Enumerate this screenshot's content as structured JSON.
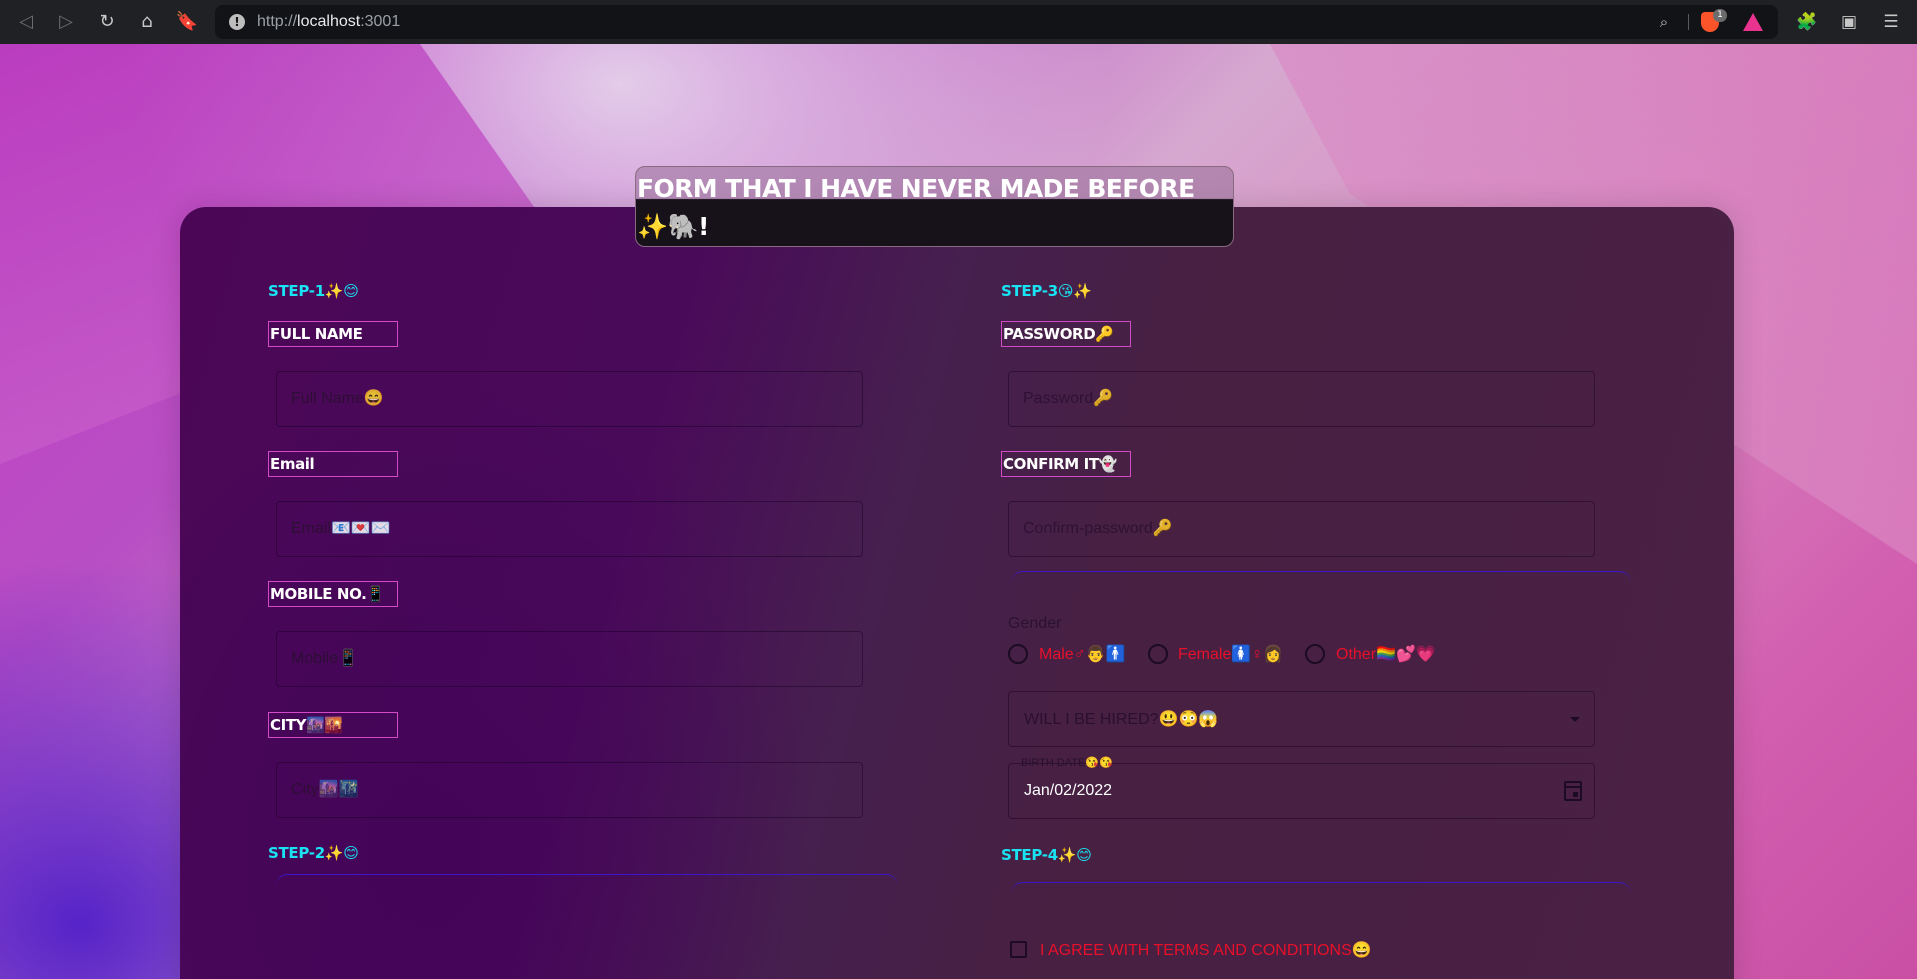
{
  "browser": {
    "url_prefix": "http://",
    "url_host": "localhost",
    "url_port": ":3001",
    "shields_count": "1",
    "icons": [
      "back-icon",
      "forward-icon",
      "reload-icon",
      "home-icon",
      "bookmark-icon",
      "info-icon",
      "zoom-icon",
      "brave-shields-icon",
      "brave-rewards-icon",
      "extensions-icon",
      "wallet-icon",
      "menu-icon"
    ]
  },
  "form": {
    "title": "FORM THAT I HAVE NEVER MADE BEFORE ✨🐘!",
    "steps": {
      "step1": "STEP-1✨😊",
      "step2": "STEP-2✨😊",
      "step3": "STEP-3😘✨",
      "step4": "STEP-4✨😊"
    },
    "left_fields": [
      {
        "label": "FULL NAME",
        "placeholder": "Full Name😄"
      },
      {
        "label": "Email",
        "placeholder": "Email📧💌✉️"
      },
      {
        "label": "MOBILE NO.📱",
        "placeholder": "Mobile📱"
      },
      {
        "label": "CITY🌆🌇",
        "placeholder": "City🌆🌃"
      }
    ],
    "right_fields": [
      {
        "label": "PASSWORD🔑",
        "placeholder": "Password🔑"
      },
      {
        "label": "CONFIRM IT👻",
        "placeholder": "Confirm-password🔑"
      }
    ],
    "gender": {
      "label": "Gender",
      "options": [
        "Male♂👨🚹",
        "Female🚺♀👩",
        "Other🏳️‍🌈💕💗"
      ]
    },
    "hire_select": {
      "placeholder": "WILL I BE HIRED?😃😳😱"
    },
    "birth_date": {
      "label": "BIRTH DATE😘😘",
      "value": "Jan/02/2022"
    },
    "terms": {
      "label": "I AGREE WITH TERMS AND CONDITIONS😄"
    },
    "colors": {
      "accent_cyan": "#19e3f2",
      "label_border": "#d24ac6",
      "error_red": "#e8102a",
      "focus_blue": "#3b17c9"
    }
  }
}
